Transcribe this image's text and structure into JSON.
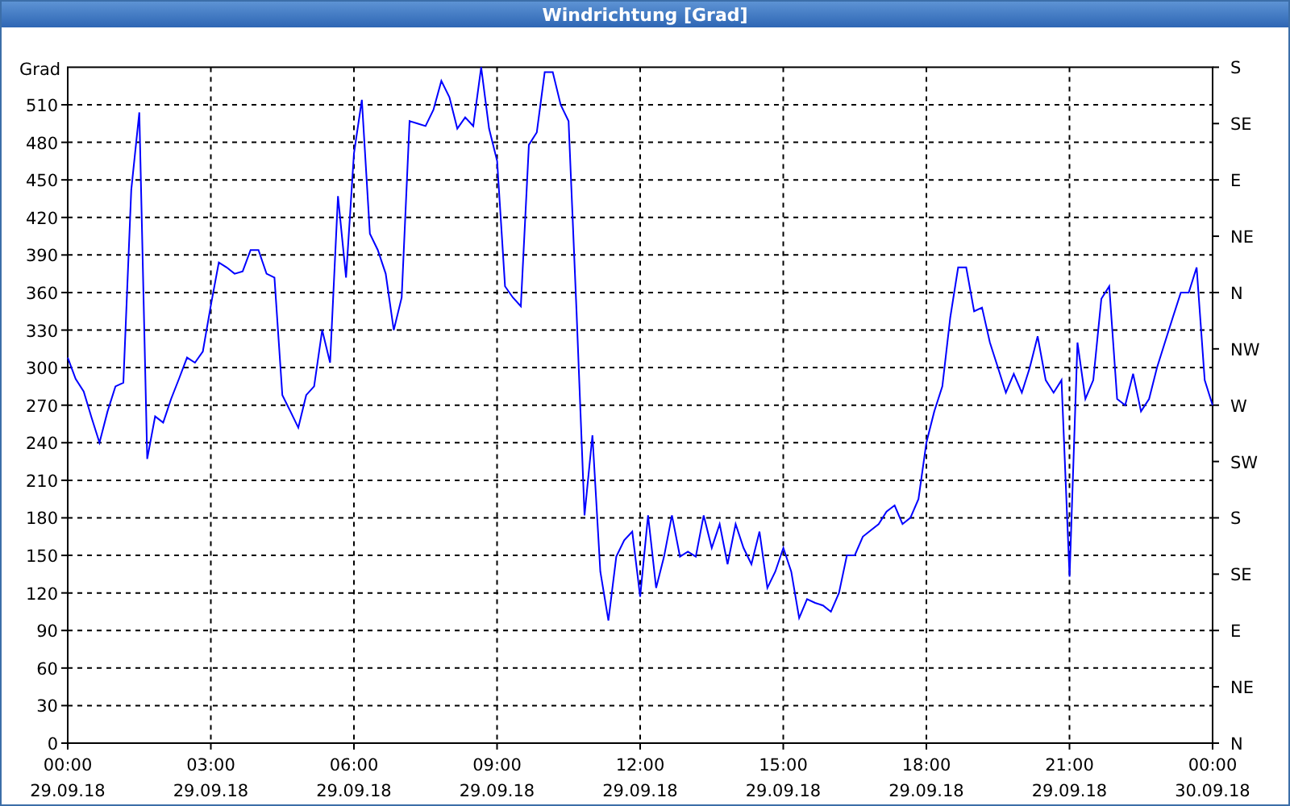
{
  "window": {
    "title": "Windrichtung [Grad]"
  },
  "chart": {
    "direction_labels": [
      "S",
      "SE",
      "E",
      "NE",
      "N",
      "NW",
      "W",
      "SW",
      "S",
      "SE",
      "E",
      "NE",
      "N"
    ],
    "chart_data": {
      "type": "line",
      "grid": true,
      "ylabel": "Grad",
      "ylim": [
        0,
        540
      ],
      "yticks": [
        0,
        30,
        60,
        90,
        120,
        150,
        180,
        210,
        240,
        270,
        300,
        330,
        360,
        390,
        420,
        450,
        480,
        510
      ],
      "categories": [
        "00:00 29.09.18",
        null,
        null,
        null,
        null,
        null,
        null,
        null,
        null,
        null,
        null,
        null,
        null,
        null,
        null,
        null,
        null,
        null,
        "03:00 29.09.18",
        null,
        null,
        null,
        null,
        null,
        null,
        null,
        null,
        null,
        null,
        null,
        null,
        null,
        null,
        null,
        null,
        null,
        "06:00 29.09.18",
        null,
        null,
        null,
        null,
        null,
        null,
        null,
        null,
        null,
        null,
        null,
        null,
        null,
        null,
        null,
        null,
        null,
        "09:00 29.09.18",
        null,
        null,
        null,
        null,
        null,
        null,
        null,
        null,
        null,
        null,
        null,
        null,
        null,
        null,
        null,
        null,
        null,
        "12:00 29.09.18",
        null,
        null,
        null,
        null,
        null,
        null,
        null,
        null,
        null,
        null,
        null,
        null,
        null,
        null,
        null,
        null,
        null,
        "15:00 29.09.18",
        null,
        null,
        null,
        null,
        null,
        null,
        null,
        null,
        null,
        null,
        null,
        null,
        null,
        null,
        null,
        null,
        null,
        "18:00 29.09.18",
        null,
        null,
        null,
        null,
        null,
        null,
        null,
        null,
        null,
        null,
        null,
        null,
        null,
        null,
        null,
        null,
        null,
        "21:00 29.09.18",
        null,
        null,
        null,
        null,
        null,
        null,
        null,
        null,
        null,
        null,
        null,
        null,
        null,
        null,
        null,
        null,
        null,
        "00:00 30.09.18"
      ],
      "series": [
        {
          "color": "#0000ff",
          "values": [
            308,
            291,
            281,
            260,
            240,
            265,
            285,
            288,
            442,
            504,
            227,
            261,
            256,
            275,
            291,
            308,
            304,
            313,
            350,
            384,
            380,
            375,
            377,
            394,
            394,
            375,
            372,
            278,
            265,
            252,
            278,
            285,
            330,
            304,
            437,
            372,
            471,
            514,
            407,
            394,
            375,
            330,
            356,
            497,
            495,
            493,
            506,
            529,
            516,
            491,
            500,
            493,
            540,
            491,
            465,
            365,
            356,
            349,
            478,
            488,
            536,
            536,
            510,
            497,
            343,
            182,
            246,
            137,
            98,
            149,
            162,
            169,
            117,
            182,
            124,
            149,
            182,
            149,
            153,
            149,
            182,
            156,
            175,
            143,
            175,
            156,
            143,
            169,
            124,
            137,
            156,
            137,
            100,
            115,
            112,
            110,
            105,
            120,
            150,
            150,
            165,
            170,
            175,
            185,
            190,
            175,
            180,
            195,
            240,
            265,
            285,
            340,
            380,
            380,
            345,
            348,
            320,
            300,
            280,
            295,
            280,
            300,
            325,
            290,
            280,
            290,
            133,
            320,
            275,
            290,
            355,
            365,
            275,
            270,
            295,
            265,
            275,
            300,
            320,
            340,
            360,
            360,
            380,
            290,
            270
          ]
        }
      ]
    }
  }
}
